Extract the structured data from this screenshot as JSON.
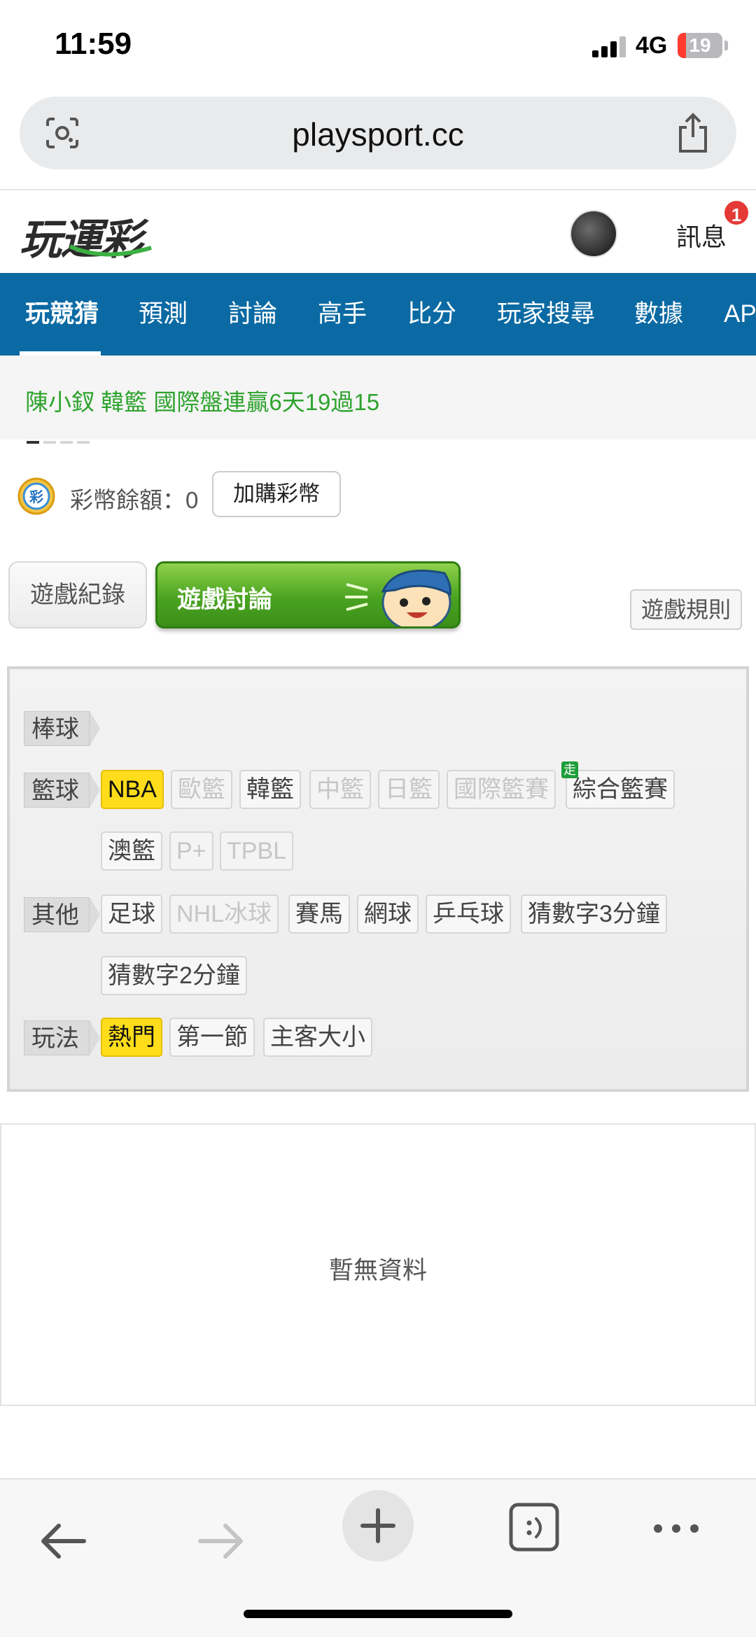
{
  "status_bar": {
    "time": "11:59",
    "network": "4G",
    "battery": "19",
    "battery_level": 0.19
  },
  "browser": {
    "url": "playsport.cc"
  },
  "header": {
    "logo": "玩運彩",
    "messages_label": "訊息",
    "messages_badge": "1"
  },
  "nav": {
    "items": [
      "玩競猜",
      "預測",
      "討論",
      "高手",
      "比分",
      "玩家搜尋",
      "數據",
      "AP"
    ],
    "active_index": 0
  },
  "marquee": {
    "text": "陳小釵  韓籃  國際盤連贏6天19過15",
    "dots": 4,
    "active_dot": 0
  },
  "balance": {
    "label": "彩幣餘額：0",
    "buy_label": "加購彩幣",
    "coin_icon_text": "彩"
  },
  "tabs": {
    "records": "遊戲紀錄",
    "discussion": "遊戲討論",
    "rules": "遊戲規則"
  },
  "filters": {
    "baseball_label": "棒球",
    "basketball_label": "籃球",
    "basketball_row1": [
      "NBA",
      "歐籃",
      "韓籃",
      "中籃",
      "日籃",
      "國際籃賽",
      "綜合籃賽"
    ],
    "basketball_row2": [
      "澳籃",
      "P+",
      "TPBL"
    ],
    "walk_tag": "走",
    "other_label": "其他",
    "other_row1": [
      "足球",
      "NHL冰球",
      "賽馬",
      "網球",
      "乒乓球",
      "猜數字3分鐘"
    ],
    "other_row2": [
      "猜數字2分鐘"
    ],
    "play_label": "玩法",
    "play_row": [
      "熱門",
      "第一節",
      "主客大小"
    ]
  },
  "content": {
    "empty_text": "暫無資料"
  },
  "colors": {
    "nav_bg": "#0b6aa3",
    "marquee_text": "#2ea32e",
    "active_chip": "#ffdd1a",
    "tab_green": "#4aa321",
    "badge_red": "#e53935"
  },
  "icons": {
    "lens": "camera-lens-icon",
    "share": "share-icon",
    "back": "arrow-left-icon",
    "forward": "arrow-right-icon",
    "new_tab": "plus-icon",
    "tabs": "tab-switcher-icon",
    "more": "more-dots-icon"
  }
}
